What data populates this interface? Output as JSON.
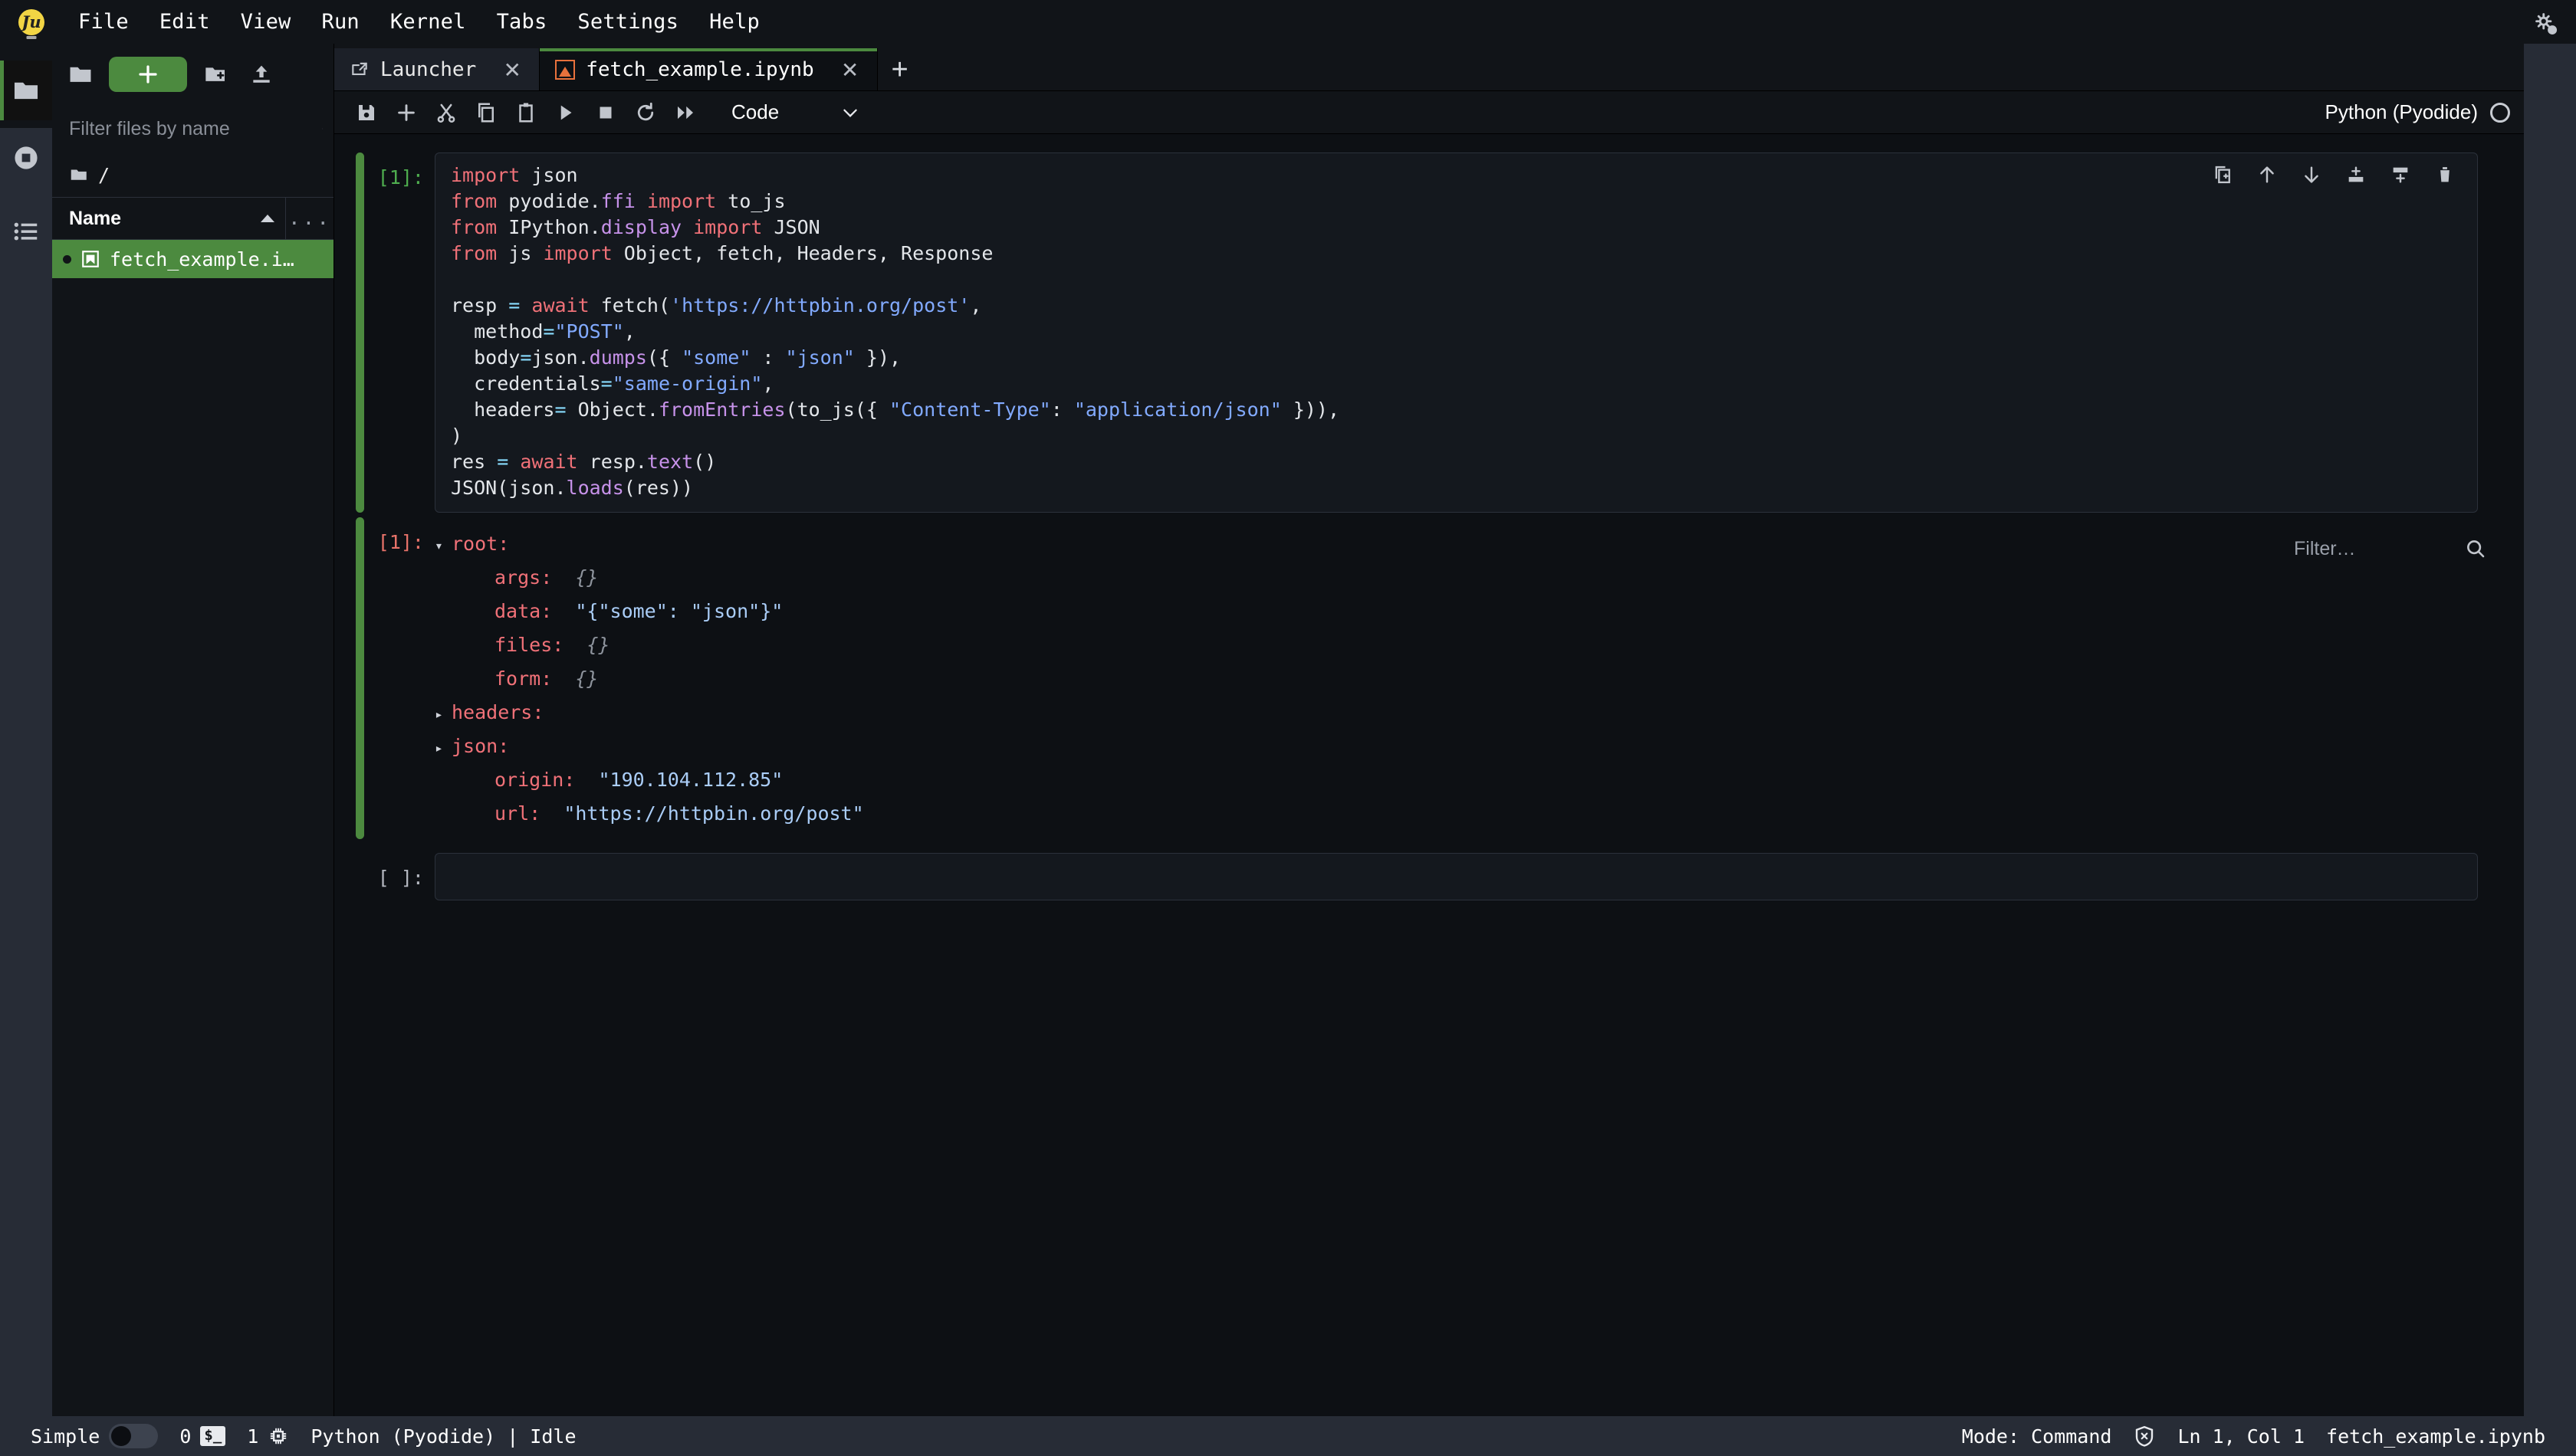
{
  "app": {
    "logo_label": "jupyter-logo",
    "menu": [
      "File",
      "Edit",
      "View",
      "Run",
      "Kernel",
      "Tabs",
      "Settings",
      "Help"
    ]
  },
  "activity_bar": {
    "items": [
      {
        "name": "file-browser",
        "icon": "folder-icon",
        "active": true
      },
      {
        "name": "running-terminals-kernels",
        "icon": "stop-circle-icon",
        "active": false
      },
      {
        "name": "table-of-contents",
        "icon": "list-icon",
        "active": false
      }
    ]
  },
  "file_browser": {
    "new_launcher_label": "+",
    "toolbar_icons": [
      "folder-icon",
      "new-launcher-button",
      "new-folder-icon",
      "upload-icon"
    ],
    "filter": {
      "placeholder": "Filter files by name",
      "value": ""
    },
    "breadcrumb": "/",
    "columns": {
      "name": "Name",
      "more": "..."
    },
    "sort_direction": "ascending",
    "files": [
      {
        "name": "fetch_example.i…",
        "icon": "notebook-icon",
        "selected": true,
        "running": true
      }
    ]
  },
  "tabs": [
    {
      "label": "Launcher",
      "icon": "launcher-icon",
      "active": false,
      "close": "✕"
    },
    {
      "label": "fetch_example.ipynb",
      "icon": "notebook-icon",
      "active": true,
      "close": "✕"
    }
  ],
  "tab_add_label": "+",
  "notebook_toolbar": {
    "buttons": [
      "save-icon",
      "insert-cell-icon",
      "cut-icon",
      "copy-icon",
      "paste-icon",
      "run-icon",
      "stop-icon",
      "restart-icon",
      "restart-run-all-icon"
    ],
    "cell_type": "Code",
    "cell_type_caret": "⌄",
    "kernel_name": "Python (Pyodide)",
    "kernel_status": "idle"
  },
  "cells": [
    {
      "type": "code",
      "prompt_in": "[1]:",
      "prompt_out": "[1]:",
      "selected": true,
      "tools": [
        "duplicate-cell-icon",
        "move-cell-up-icon",
        "move-cell-down-icon",
        "insert-cell-above-icon",
        "insert-cell-below-icon",
        "delete-cell-icon"
      ],
      "source_lines": [
        [
          {
            "t": "import",
            "c": "k"
          },
          {
            "t": " json",
            "c": "pl"
          }
        ],
        [
          {
            "t": "from",
            "c": "k"
          },
          {
            "t": " pyodide.",
            "c": "pl"
          },
          {
            "t": "ffi",
            "c": "at"
          },
          {
            "t": " ",
            "c": "pl"
          },
          {
            "t": "import",
            "c": "k"
          },
          {
            "t": " to_js",
            "c": "pl"
          }
        ],
        [
          {
            "t": "from",
            "c": "k"
          },
          {
            "t": " IPython.",
            "c": "pl"
          },
          {
            "t": "display",
            "c": "at"
          },
          {
            "t": " ",
            "c": "pl"
          },
          {
            "t": "import",
            "c": "k"
          },
          {
            "t": " JSON",
            "c": "pl"
          }
        ],
        [
          {
            "t": "from",
            "c": "k"
          },
          {
            "t": " js ",
            "c": "pl"
          },
          {
            "t": "import",
            "c": "k"
          },
          {
            "t": " Object, fetch, Headers, Response",
            "c": "pl"
          }
        ],
        [
          {
            "t": "",
            "c": "pl"
          }
        ],
        [
          {
            "t": "resp ",
            "c": "pl"
          },
          {
            "t": "=",
            "c": "op"
          },
          {
            "t": " ",
            "c": "pl"
          },
          {
            "t": "await",
            "c": "k"
          },
          {
            "t": " fetch(",
            "c": "pl"
          },
          {
            "t": "'https://httpbin.org/post'",
            "c": "s"
          },
          {
            "t": ",",
            "c": "pl"
          }
        ],
        [
          {
            "t": "  method",
            "c": "pl"
          },
          {
            "t": "=",
            "c": "op"
          },
          {
            "t": "\"POST\"",
            "c": "s"
          },
          {
            "t": ",",
            "c": "pl"
          }
        ],
        [
          {
            "t": "  body",
            "c": "pl"
          },
          {
            "t": "=",
            "c": "op"
          },
          {
            "t": "json.",
            "c": "pl"
          },
          {
            "t": "dumps",
            "c": "at"
          },
          {
            "t": "({ ",
            "c": "pl"
          },
          {
            "t": "\"some\"",
            "c": "s"
          },
          {
            "t": " : ",
            "c": "pl"
          },
          {
            "t": "\"json\"",
            "c": "s"
          },
          {
            "t": " }),",
            "c": "pl"
          }
        ],
        [
          {
            "t": "  credentials",
            "c": "pl"
          },
          {
            "t": "=",
            "c": "op"
          },
          {
            "t": "\"same-origin\"",
            "c": "s"
          },
          {
            "t": ",",
            "c": "pl"
          }
        ],
        [
          {
            "t": "  headers",
            "c": "pl"
          },
          {
            "t": "=",
            "c": "op"
          },
          {
            "t": " Object.",
            "c": "pl"
          },
          {
            "t": "fromEntries",
            "c": "at"
          },
          {
            "t": "(to_js({ ",
            "c": "pl"
          },
          {
            "t": "\"Content-Type\"",
            "c": "s"
          },
          {
            "t": ": ",
            "c": "pl"
          },
          {
            "t": "\"application/json\"",
            "c": "s"
          },
          {
            "t": " })),",
            "c": "pl"
          }
        ],
        [
          {
            "t": ")",
            "c": "pl"
          }
        ],
        [
          {
            "t": "res ",
            "c": "pl"
          },
          {
            "t": "=",
            "c": "op"
          },
          {
            "t": " ",
            "c": "pl"
          },
          {
            "t": "await",
            "c": "k"
          },
          {
            "t": " resp.",
            "c": "pl"
          },
          {
            "t": "text",
            "c": "at"
          },
          {
            "t": "()",
            "c": "pl"
          }
        ],
        [
          {
            "t": "JSON(json.",
            "c": "pl"
          },
          {
            "t": "loads",
            "c": "at"
          },
          {
            "t": "(res))",
            "c": "pl"
          }
        ]
      ],
      "output": {
        "type": "json-tree",
        "filter": {
          "placeholder": "Filter…",
          "value": ""
        },
        "nodes": [
          {
            "caret": "▾",
            "key": "root:",
            "value": "",
            "value_type": "none",
            "indent": 0
          },
          {
            "caret": "",
            "key": "args:",
            "value": "{}",
            "value_type": "empty",
            "indent": 1
          },
          {
            "caret": "",
            "key": "data:",
            "value": "\"{\"some\": \"json\"}\"",
            "value_type": "string",
            "indent": 1
          },
          {
            "caret": "",
            "key": "files:",
            "value": "{}",
            "value_type": "empty",
            "indent": 1
          },
          {
            "caret": "",
            "key": "form:",
            "value": "{}",
            "value_type": "empty",
            "indent": 1
          },
          {
            "caret": "▸",
            "key": "headers:",
            "value": "",
            "value_type": "none",
            "indent": 0
          },
          {
            "caret": "▸",
            "key": "json:",
            "value": "",
            "value_type": "none",
            "indent": 0
          },
          {
            "caret": "",
            "key": "origin:",
            "value": "\"190.104.112.85\"",
            "value_type": "string",
            "indent": 1
          },
          {
            "caret": "",
            "key": "url:",
            "value": "\"https://httpbin.org/post\"",
            "value_type": "string",
            "indent": 1
          }
        ]
      }
    },
    {
      "type": "code",
      "prompt_in": "[ ]:",
      "selected": false,
      "source_lines": [],
      "output": null
    }
  ],
  "status_bar": {
    "simple_label": "Simple",
    "simple_enabled": false,
    "terminals_count": "0",
    "terminal_icon_label": "$_",
    "kernels_count": "1",
    "kernel_session": "Python (Pyodide) | Idle",
    "mode": "Mode: Command",
    "trust_icon": "not-trusted-shield-icon",
    "cursor_position": "Ln 1, Col 1",
    "filename": "fetch_example.ipynb"
  },
  "colors": {
    "accent_green": "#4c8a3f",
    "notebook_orange": "#e8713c",
    "keyword": "#f07178",
    "string": "#82aaff",
    "attribute": "#c792ea",
    "operator": "#89ddff",
    "json_key": "#f07178",
    "json_string": "#aacdf7",
    "bg_dark": "#0d1014",
    "bg_panel": "#111418",
    "statusbar_bg": "#272c36"
  }
}
